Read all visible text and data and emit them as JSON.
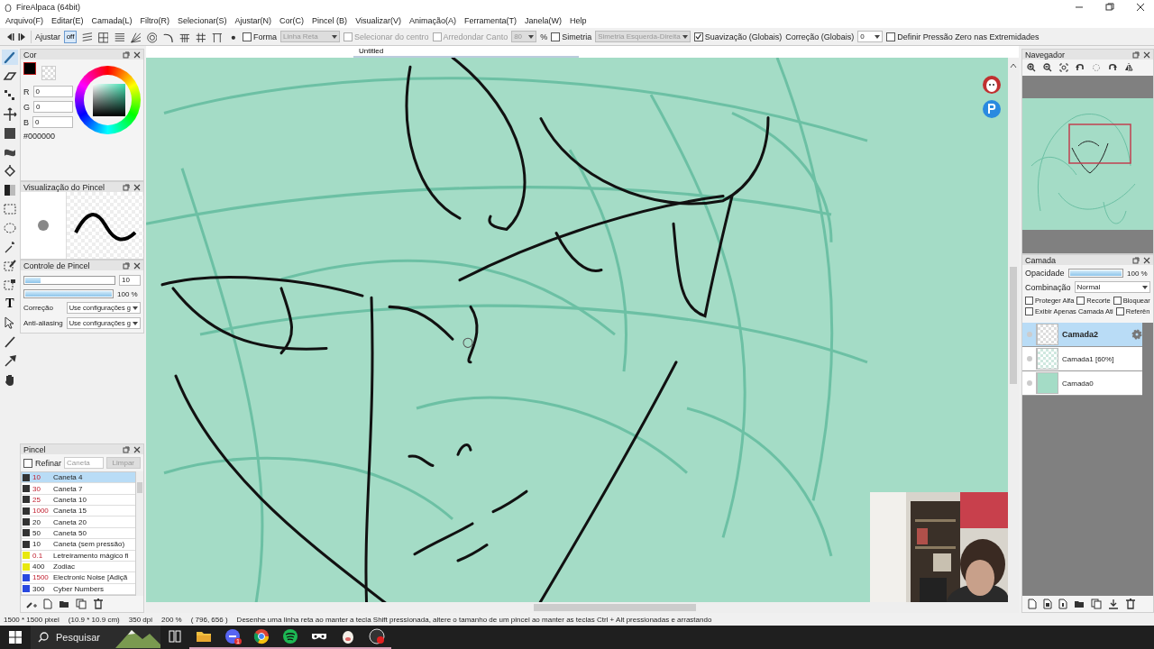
{
  "window": {
    "title": "FireAlpaca (64bit)"
  },
  "menu": [
    "Arquivo(F)",
    "Editar(E)",
    "Camada(L)",
    "Filtro(R)",
    "Selecionar(S)",
    "Ajustar(N)",
    "Cor(C)",
    "Pincel (B)",
    "Visualizar(V)",
    "Animação(A)",
    "Ferramenta(T)",
    "Janela(W)",
    "Help"
  ],
  "toolbar": {
    "snap_label": "Ajustar",
    "snap_off": "off",
    "snaps": [
      {
        "kind": "off",
        "selected": true
      },
      {
        "kind": "parallel",
        "selected": false
      },
      {
        "kind": "cross",
        "selected": false
      },
      {
        "kind": "lines",
        "selected": false
      },
      {
        "kind": "radial",
        "selected": false
      },
      {
        "kind": "concentric",
        "selected": false
      },
      {
        "kind": "curve",
        "selected": false
      },
      {
        "kind": "grid3",
        "selected": false
      },
      {
        "kind": "grid",
        "selected": false
      },
      {
        "kind": "perspective",
        "selected": false
      },
      {
        "kind": "dot",
        "selected": false
      }
    ],
    "controls": [
      {
        "kind": "checkbox",
        "label": "Forma",
        "checked": false,
        "disabled": false
      },
      {
        "kind": "select",
        "value": "Linha Reta",
        "disabled": true
      },
      {
        "kind": "checkbox",
        "label": "Selecionar do centro",
        "checked": false,
        "disabled": true
      },
      {
        "kind": "checkbox",
        "label": "Arredondar Canto",
        "checked": false,
        "disabled": true
      },
      {
        "kind": "select",
        "value": "80",
        "disabled": true
      },
      {
        "kind": "label",
        "text": "%"
      },
      {
        "kind": "checkbox",
        "label": "Simetria",
        "checked": false,
        "disabled": false
      },
      {
        "kind": "select",
        "value": "Simetria Esquerda-Direita",
        "disabled": true
      },
      {
        "kind": "checkbox",
        "label": "Suavização (Globais)",
        "checked": true,
        "disabled": false
      },
      {
        "kind": "label",
        "text": "Correção (Globais)"
      },
      {
        "kind": "select",
        "value": "0",
        "disabled": false
      },
      {
        "kind": "checkbox",
        "label": "Definir Pressão Zero nas Extremidades",
        "checked": false,
        "disabled": false
      }
    ]
  },
  "tools": [
    {
      "kind": "brush",
      "selected": true
    },
    {
      "kind": "eraser",
      "selected": false
    },
    {
      "kind": "dots",
      "selected": false
    },
    {
      "kind": "move",
      "selected": false
    },
    {
      "kind": "fill-rect",
      "selected": false
    },
    {
      "kind": "blob",
      "selected": false
    },
    {
      "kind": "bucket",
      "selected": false
    },
    {
      "kind": "gradient",
      "selected": false
    },
    {
      "kind": "select-rect",
      "selected": false
    },
    {
      "kind": "lasso",
      "selected": false
    },
    {
      "kind": "wand",
      "selected": false
    },
    {
      "kind": "select-pen",
      "selected": false
    },
    {
      "kind": "select-eraser",
      "selected": false
    },
    {
      "kind": "text",
      "selected": false,
      "text": "T"
    },
    {
      "kind": "pointer",
      "selected": false
    },
    {
      "kind": "pen",
      "selected": false
    },
    {
      "kind": "dropper",
      "selected": false
    },
    {
      "kind": "hand",
      "selected": false
    }
  ],
  "color_panel": {
    "title": "Cor",
    "color": "#000000",
    "channels": [
      {
        "label": "R",
        "value": "0"
      },
      {
        "label": "G",
        "value": "0"
      },
      {
        "label": "B",
        "value": "0"
      }
    ],
    "hex": "#000000"
  },
  "brush_preview": {
    "title": "Visualização do Pincel"
  },
  "brush_control": {
    "title": "Controle de Pincel",
    "size": {
      "level": 0.17,
      "value": "10"
    },
    "opacity": {
      "level": 1.0,
      "reading": "100 %"
    },
    "options": [
      {
        "label": "Correção",
        "value": "Use configurações g"
      },
      {
        "label": "Anti-aliasing",
        "value": "Use configurações g"
      }
    ]
  },
  "brush_panel": {
    "title": "Pincel",
    "refine": {
      "label": "Refinar",
      "checked": false
    },
    "search": {
      "placeholder": "Caneta"
    },
    "clear_button": {
      "label": "Limpar",
      "disabled": true
    },
    "brushes": [
      {
        "size": "10",
        "name": "Caneta 4",
        "color": "#333333",
        "pressure": true,
        "selected": true
      },
      {
        "size": "30",
        "name": "Caneta 7",
        "color": "#333333",
        "pressure": true,
        "selected": false
      },
      {
        "size": "25",
        "name": "Caneta 10",
        "color": "#333333",
        "pressure": true,
        "selected": false
      },
      {
        "size": "1000",
        "name": "Caneta 15",
        "color": "#333333",
        "pressure": true,
        "selected": false
      },
      {
        "size": "20",
        "name": "Caneta 20",
        "color": "#333333",
        "pressure": false,
        "selected": false
      },
      {
        "size": "50",
        "name": "Caneta 50",
        "color": "#333333",
        "pressure": false,
        "selected": false
      },
      {
        "size": "10",
        "name": "Caneta (sem pressão)",
        "color": "#333333",
        "pressure": false,
        "selected": false
      },
      {
        "size": "0.1",
        "name": "Letreiramento mágico fi",
        "color": "#e8e810",
        "pressure": true,
        "selected": false
      },
      {
        "size": "400",
        "name": "Zodiac",
        "color": "#e8e810",
        "pressure": false,
        "selected": false
      },
      {
        "size": "1500",
        "name": "Electronic Noise [Adiçã",
        "color": "#2848e0",
        "pressure": true,
        "selected": false
      },
      {
        "size": "300",
        "name": "Cyber Numbers",
        "color": "#2848e0",
        "pressure": false,
        "selected": false
      }
    ]
  },
  "canvas": {
    "tab": "Untitled"
  },
  "navigator": {
    "title": "Navegador"
  },
  "layer_panel": {
    "title": "Camada",
    "opacity": {
      "label": "Opacidade",
      "level": 1.0,
      "reading": "100 %"
    },
    "blend": {
      "label": "Combinação",
      "value": "Normal"
    },
    "options": [
      {
        "label": "Proteger Alfa",
        "checked": false
      },
      {
        "label": "Recorte",
        "checked": false
      },
      {
        "label": "Bloquear",
        "checked": false
      },
      {
        "label": "Exibir Apenas Camada Ati",
        "checked": false
      },
      {
        "label": "Referên",
        "checked": false
      }
    ],
    "layers": [
      {
        "name": "Camada2",
        "kind": "transparent",
        "selected": true
      },
      {
        "name": "Camada1 [60%]",
        "kind": "sketch",
        "selected": false
      },
      {
        "name": "Camada0",
        "kind": "fill",
        "selected": false
      }
    ]
  },
  "status_bar": [
    "1500 * 1500 pixel",
    "(10.9 * 10.9 cm)",
    "350 dpi",
    "200 %",
    "( 796, 656 )",
    "Desenhe uma linha reta ao manter a tecla Shift pressionada, altere o tamanho de um pincel ao manter as teclas Ctrl + Alt pressionadas e arrastando"
  ],
  "taskbar": {
    "search": {
      "placeholder": "Pesquisar"
    },
    "apps": [
      {
        "kind": "task-view",
        "running": false
      },
      {
        "kind": "folder",
        "running": true
      },
      {
        "kind": "chat",
        "running": true,
        "badge": "1"
      },
      {
        "kind": "browser",
        "running": true
      },
      {
        "kind": "music",
        "running": true
      },
      {
        "kind": "mask",
        "running": true
      },
      {
        "kind": "alpaca",
        "running": true
      },
      {
        "kind": "record",
        "running": true
      }
    ]
  }
}
